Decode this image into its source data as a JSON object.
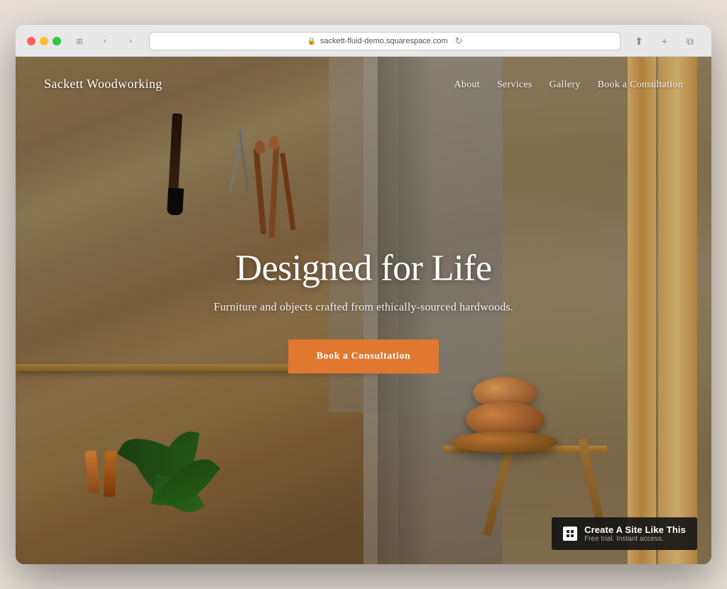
{
  "browser": {
    "url": "sackett-fluid-demo.squarespace.com",
    "refresh_icon": "↻"
  },
  "site": {
    "logo": "Sackett Woodworking",
    "nav": {
      "items": [
        {
          "id": "about",
          "label": "About"
        },
        {
          "id": "services",
          "label": "Services"
        },
        {
          "id": "gallery",
          "label": "Gallery"
        },
        {
          "id": "book",
          "label": "Book a Consultation"
        }
      ]
    },
    "hero": {
      "title": "Designed for Life",
      "subtitle": "Furniture and objects crafted from ethically-sourced hardwoods.",
      "cta_label": "Book a Consultation"
    },
    "badge": {
      "main": "Create A Site Like This",
      "sub": "Free trial. Instant access.",
      "logo_text": "S"
    }
  }
}
